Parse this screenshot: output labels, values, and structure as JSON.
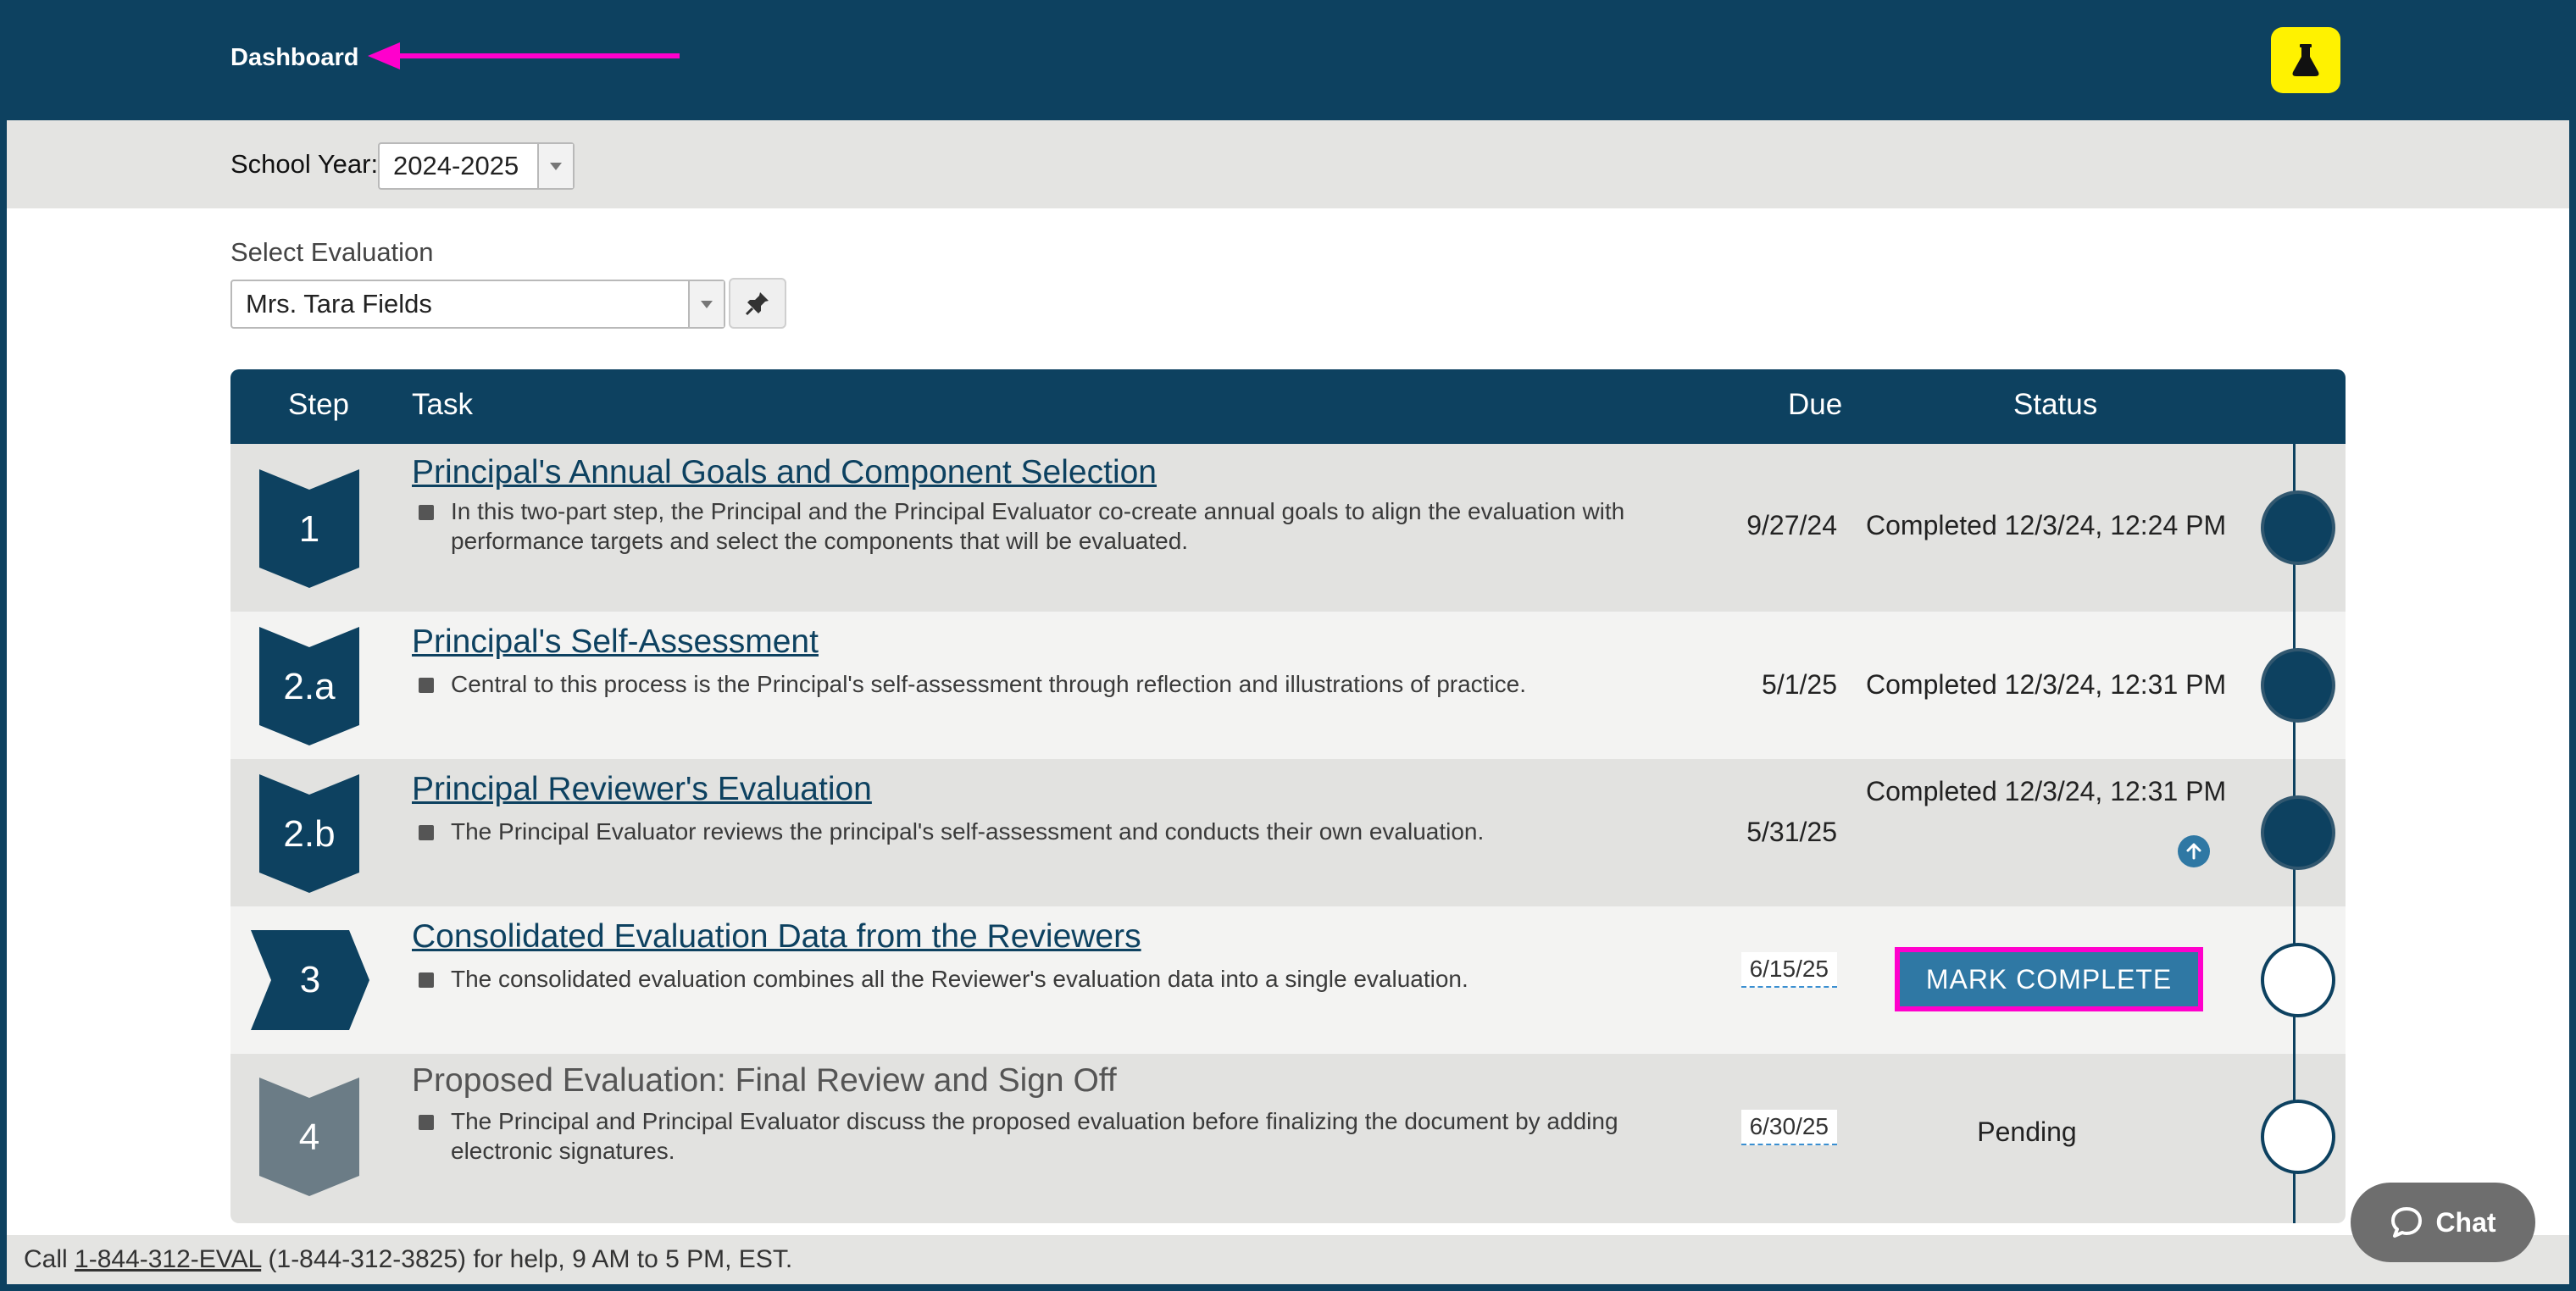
{
  "header": {
    "dashboard_label": "Dashboard",
    "lab_icon": "flask-icon"
  },
  "school_year": {
    "label": "School Year:",
    "value": "2024-2025"
  },
  "evaluation": {
    "label": "Select Evaluation",
    "value": "Mrs. Tara Fields",
    "pin_icon": "pin-icon"
  },
  "table": {
    "headers": {
      "step": "Step",
      "task": "Task",
      "due": "Due",
      "status": "Status"
    },
    "rows": [
      {
        "step": "1",
        "title": "Principal's Annual Goals and Component Selection",
        "description": "In this two-part step, the Principal and the Principal Evaluator co-create annual goals to align the evaluation with performance targets and select the components that will be evaluated.",
        "due": "9/27/24",
        "status": "Completed 12/3/24, 12:24 PM"
      },
      {
        "step": "2.a",
        "title": "Principal's Self-Assessment",
        "description": "Central to this process is the Principal's self-assessment through reflection and illustrations of practice.",
        "due": "5/1/25",
        "status": "Completed 12/3/24, 12:31 PM"
      },
      {
        "step": "2.b",
        "title": "Principal Reviewer's Evaluation",
        "description": "The Principal Evaluator reviews the principal's self-assessment and conducts their own evaluation.",
        "due": "5/31/25",
        "status": "Completed 12/3/24, 12:31 PM"
      },
      {
        "step": "3",
        "title": "Consolidated Evaluation Data from the Reviewers",
        "description": "The consolidated evaluation combines all the Reviewer's evaluation data into a single evaluation.",
        "due": "6/15/25",
        "status": "MARK COMPLETE"
      },
      {
        "step": "4",
        "title": "Proposed Evaluation: Final Review and Sign Off",
        "description": "The Principal and Principal Evaluator discuss the proposed evaluation before finalizing the document by adding electronic signatures.",
        "due": "6/30/25",
        "status": "Pending"
      }
    ]
  },
  "footer": {
    "prefix": "Call",
    "phone_link": "1-844-312-EVAL",
    "suffix": "(1-844-312-3825) for help, 9 AM to 5 PM, EST."
  },
  "chat": {
    "label": "Chat"
  },
  "colors": {
    "navy": "#0d4160",
    "accent_blue": "#2f78a4",
    "annotation_magenta": "#ff00cc",
    "lab_yellow": "#fff200"
  }
}
